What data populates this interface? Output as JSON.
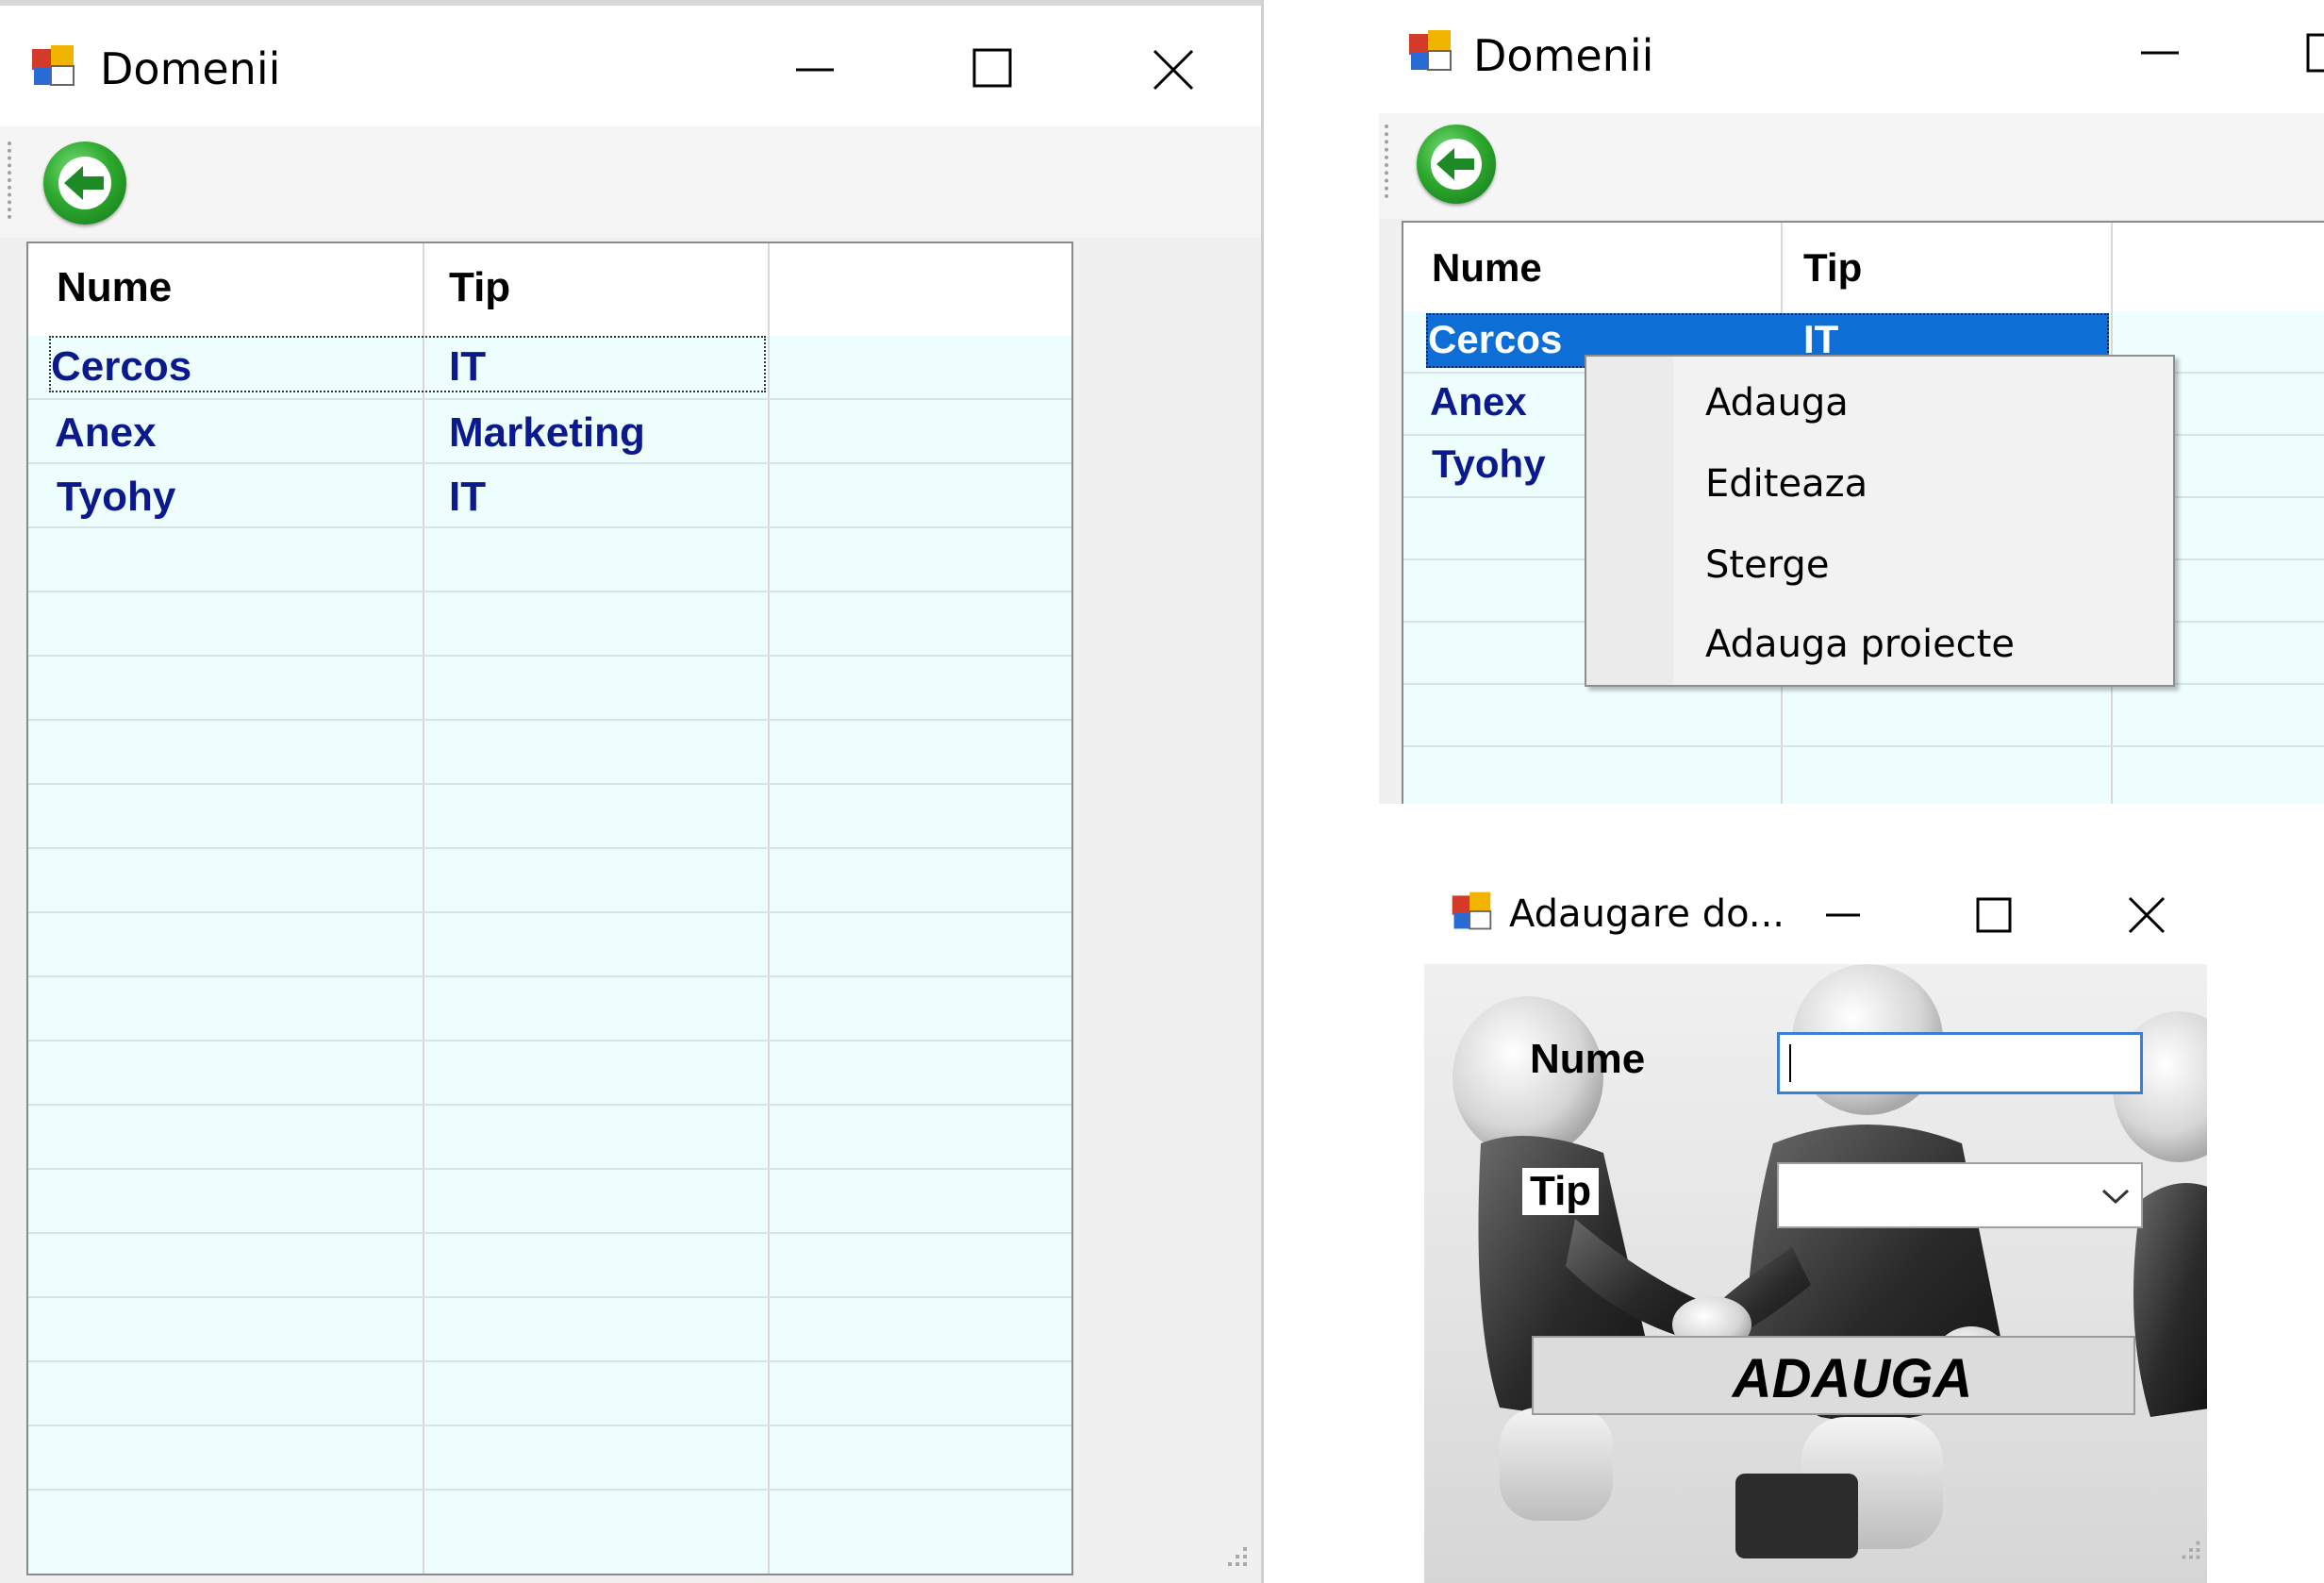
{
  "windows": {
    "left": {
      "title": "Domenii",
      "columns": [
        "Nume",
        "Tip"
      ],
      "rows": [
        {
          "nume": "Cercos",
          "tip": "IT"
        },
        {
          "nume": "Anex",
          "tip": "Marketing"
        },
        {
          "nume": "Tyohy",
          "tip": "IT"
        }
      ]
    },
    "right": {
      "title": "Domenii",
      "columns": [
        "Nume",
        "Tip"
      ],
      "rows": [
        {
          "nume": "Cercos",
          "tip": "IT"
        },
        {
          "nume": "Anex",
          "tip": ""
        },
        {
          "nume": "Tyohy",
          "tip": ""
        }
      ],
      "context_menu": [
        "Adauga",
        "Editeaza",
        "Sterge",
        "Adauga proiecte"
      ]
    },
    "dialog": {
      "title": "Adaugare do...",
      "nume_label": "Nume",
      "tip_label": "Tip",
      "nume_value": "",
      "tip_value": "",
      "submit_label": "ADAUGA"
    }
  },
  "colors": {
    "grid_bg": "#eefefe",
    "cell_text": "#0a1a8c",
    "selection": "#0d6fd6",
    "input_focus": "#3a7fd6"
  },
  "icons": [
    "app-icon",
    "back-arrow-icon",
    "minimize-icon",
    "maximize-icon",
    "close-icon",
    "chevron-down-icon",
    "resize-grip-icon"
  ]
}
